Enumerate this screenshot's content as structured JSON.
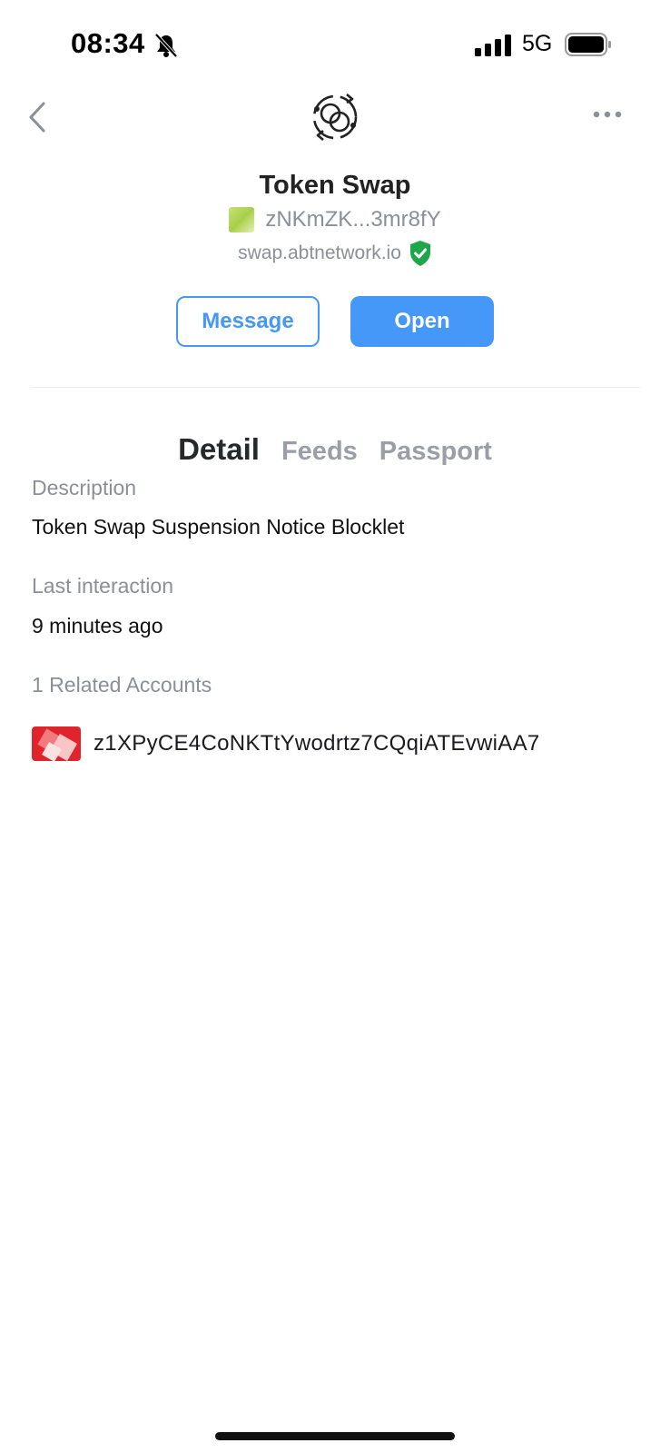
{
  "status_bar": {
    "time": "08:34",
    "network": "5G"
  },
  "app": {
    "title": "Token Swap",
    "did_short": "zNKmZK...3mr8fY",
    "domain": "swap.abtnetwork.io"
  },
  "actions": {
    "message_label": "Message",
    "open_label": "Open"
  },
  "tabs": [
    {
      "label": "Detail",
      "active": true
    },
    {
      "label": "Feeds",
      "active": false
    },
    {
      "label": "Passport",
      "active": false
    }
  ],
  "detail": {
    "description_label": "Description",
    "description_value": "Token Swap Suspension Notice Blocklet",
    "last_interaction_label": "Last interaction",
    "last_interaction_value": "9 minutes ago",
    "related_label": "1 Related Accounts",
    "related_accounts": [
      {
        "address": "z1XPyCE4CoNKTtYwodrtz7CQqiATEvwiAA7"
      }
    ]
  },
  "colors": {
    "accent": "#4598f7",
    "verified": "#1fa64a"
  },
  "icons": {
    "back": "chevron-left-icon",
    "more": "more-horizontal-icon",
    "logo": "token-swap-icon",
    "verified": "verified-shield-icon",
    "bell": "bell-off-icon"
  }
}
